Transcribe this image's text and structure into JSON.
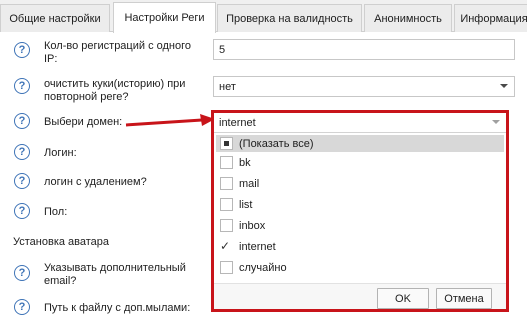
{
  "tabs": [
    {
      "label": "Общие настройки"
    },
    {
      "label": "Настройки Реги"
    },
    {
      "label": "Проверка на валидность"
    },
    {
      "label": "Анонимность"
    },
    {
      "label": "Информация"
    }
  ],
  "active_tab": "Настройки Реги",
  "form": {
    "reg_count": {
      "label": "Кол-во регистраций с одного IP:",
      "value": "5"
    },
    "clear_cookies": {
      "label": "очистить куки(историю) при повторной реге?",
      "value": "нет"
    },
    "domain": {
      "label": "Выбери домен:",
      "value": "internet"
    },
    "login": {
      "label": "Логин:"
    },
    "login_delete": {
      "label": "логин с удалением?"
    },
    "gender": {
      "label": "Пол:"
    },
    "avatar_section": "Установка аватара",
    "extra_email": {
      "label": "Указывать дополнительный email?"
    },
    "emails_file": {
      "label": "Путь к файлу с доп.мылами:"
    }
  },
  "dropdown": {
    "show_all": "(Показать все)",
    "items": [
      {
        "label": "bk",
        "checked": false
      },
      {
        "label": "mail",
        "checked": false
      },
      {
        "label": "list",
        "checked": false
      },
      {
        "label": "inbox",
        "checked": false
      },
      {
        "label": "internet",
        "checked": true
      },
      {
        "label": "случайно",
        "checked": false
      }
    ],
    "ok": "OK",
    "cancel": "Отмена"
  },
  "colors": {
    "highlight_border": "#c8141a",
    "arrow": "#c8141a",
    "help_icon": "#3f74b7"
  }
}
